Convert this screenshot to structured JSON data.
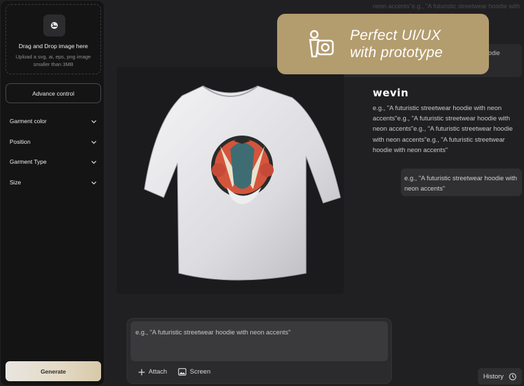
{
  "sidebar": {
    "upload": {
      "title": "Drag and Drop image here",
      "hint": "Upload a svg, ai, eps, png image smaller than 3MB",
      "icon": "upload-image-icon"
    },
    "advance_control": "Advance control",
    "dropdowns": [
      {
        "label": "Garment color"
      },
      {
        "label": "Position"
      },
      {
        "label": "Garment Type"
      },
      {
        "label": "Size"
      }
    ],
    "generate": "Generate"
  },
  "banner": {
    "line1": "Perfect UI/UX",
    "line2": "with prototype",
    "color": "#b39c6e"
  },
  "chat": {
    "faded_top": "neon accents\"e.g., \"A futuristic streetwear hoodie with neon accents\"e.g., \"A futuristic streetwear",
    "ghost_text": "oodie",
    "logo": "wevin",
    "response": "e.g., \"A futuristic streetwear hoodie with neon accents\"e.g., \"A futuristic streetwear hoodie with neon accents\"e.g., \"A futuristic streetwear hoodie with neon accents\"e.g., \"A futuristic streetwear hoodie with neon accents\"",
    "user_message": "e.g., \"A futuristic streetwear hoodie with neon accents\""
  },
  "prompt": {
    "placeholder": "e.g., \"A futuristic streetwear hoodie with neon accents\"",
    "attach": "Attach",
    "screen": "Screen"
  },
  "history": "History"
}
